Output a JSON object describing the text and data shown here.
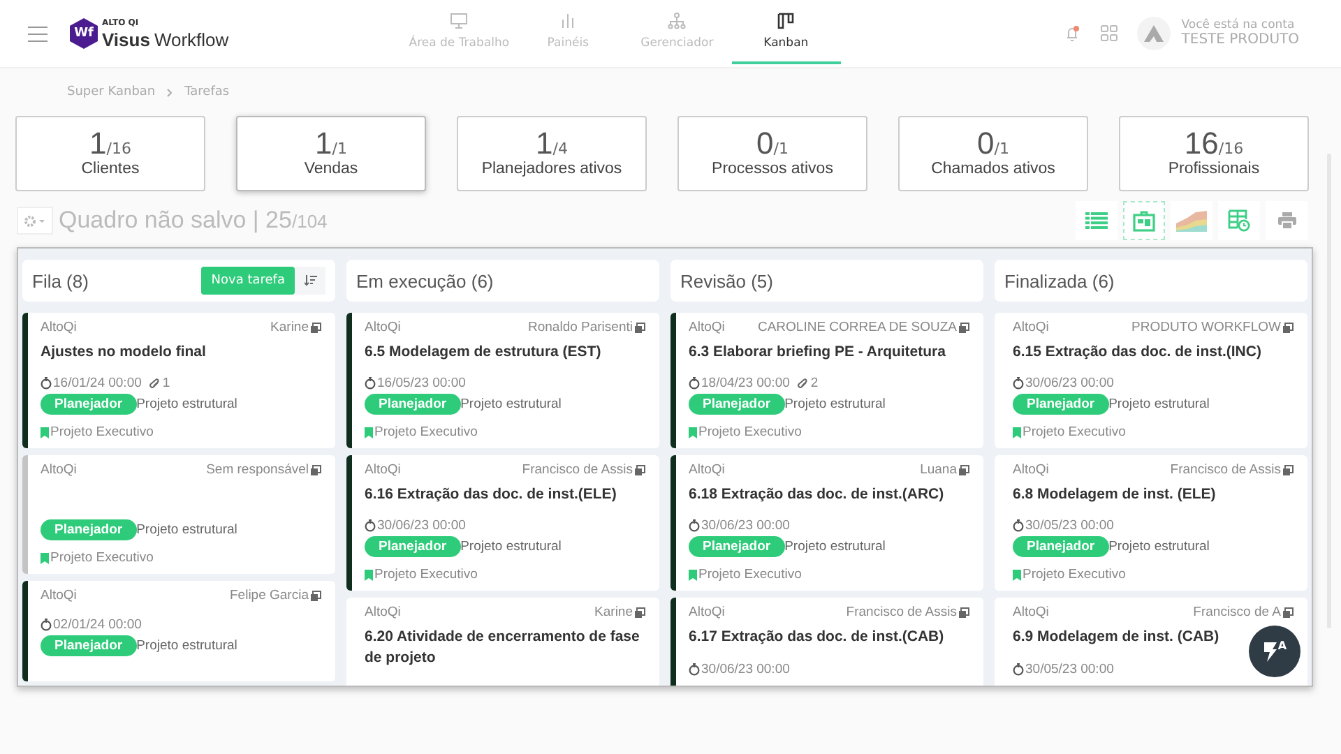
{
  "header": {
    "brand_small": "ALTO QI",
    "brand_bold": "Visus",
    "brand_light": "Workflow",
    "logo_text": "Wf",
    "nav": [
      {
        "label": "Área de Trabalho",
        "kind": "monitor",
        "selected": false
      },
      {
        "label": "Painéis",
        "kind": "bars",
        "selected": false
      },
      {
        "label": "Gerenciador",
        "kind": "tree",
        "selected": false
      },
      {
        "label": "Kanban",
        "kind": "kanban",
        "selected": true
      }
    ],
    "account_caption": "Você está na conta",
    "account_name": "TESTE PRODUTO"
  },
  "breadcrumb": [
    "Super Kanban",
    "Tarefas"
  ],
  "stats": [
    {
      "value": "1",
      "total": "/16",
      "label": "Clientes",
      "selected": false
    },
    {
      "value": "1",
      "total": "/1",
      "label": "Vendas",
      "selected": true
    },
    {
      "value": "1",
      "total": "/4",
      "label": "Planejadores ativos",
      "selected": false
    },
    {
      "value": "0",
      "total": "/1",
      "label": "Processos ativos",
      "selected": false
    },
    {
      "value": "0",
      "total": "/1",
      "label": "Chamados ativos",
      "selected": false
    },
    {
      "value": "16",
      "total": "/16",
      "label": "Profissionais",
      "selected": false
    }
  ],
  "board_title": "Quadro não salvo | 25",
  "board_total": "/104",
  "views": [
    {
      "kind": "list",
      "selected": false
    },
    {
      "kind": "kanban",
      "selected": true
    },
    {
      "kind": "chart",
      "selected": false
    },
    {
      "kind": "schedule",
      "selected": false
    },
    {
      "kind": "print",
      "selected": false
    }
  ],
  "columns": [
    {
      "title": "Fila (8)",
      "new_button": "Nova tarefa",
      "cards": [
        {
          "company": "AltoQi",
          "assignee": "Karine",
          "title": "Ajustes no modelo final",
          "date": "16/01/24 00:00",
          "attachments": "1",
          "tag": "Planejador",
          "project": "Projeto estrutural",
          "phase": "Projeto Executivo",
          "color": "#0f2e1e"
        },
        {
          "company": "AltoQi",
          "assignee": "Sem responsável",
          "tag": "Planejador",
          "project": "Projeto estrutural",
          "phase": "Projeto Executivo",
          "color": "#c4c4c4"
        },
        {
          "company": "AltoQi",
          "assignee": "Felipe Garcia",
          "date": "02/01/24 00:00",
          "tag": "Planejador",
          "project": "Projeto estrutural",
          "color": "#0f2e1e"
        }
      ]
    },
    {
      "title": "Em execução (6)",
      "cards": [
        {
          "company": "AltoQi",
          "assignee": "Ronaldo Parisenti",
          "title": "6.5 Modelagem de estrutura (EST)",
          "date": "16/05/23 00:00",
          "tag": "Planejador",
          "project": "Projeto estrutural",
          "phase": "Projeto Executivo",
          "color": "#0f2e1e"
        },
        {
          "company": "AltoQi",
          "assignee": "Francisco de Assis",
          "title": "6.16 Extração das doc. de inst.(ELE)",
          "date": "30/06/23 00:00",
          "tag": "Planejador",
          "project": "Projeto estrutural",
          "phase": "Projeto Executivo",
          "color": "#0f2e1e"
        },
        {
          "company": "AltoQi",
          "assignee": "Karine",
          "title": "6.20 Atividade de encerramento de fase de projeto",
          "color": "#ffffff"
        }
      ]
    },
    {
      "title": "Revisão (5)",
      "cards": [
        {
          "company": "AltoQi",
          "assignee": "CAROLINE CORREA DE SOUZA",
          "title": "6.3 Elaborar briefing PE - Arquitetura",
          "date": "18/04/23 00:00",
          "attachments": "2",
          "tag": "Planejador",
          "project": "Projeto estrutural",
          "phase": "Projeto Executivo",
          "color": "#0f2e1e"
        },
        {
          "company": "AltoQi",
          "assignee": "Luana",
          "title": "6.18 Extração das doc. de inst.(ARC)",
          "date": "30/06/23 00:00",
          "tag": "Planejador",
          "project": "Projeto estrutural",
          "phase": "Projeto Executivo",
          "color": "#0f2e1e"
        },
        {
          "company": "AltoQi",
          "assignee": "Francisco de Assis",
          "title": "6.17 Extração das doc. de inst.(CAB)",
          "date": "30/06/23 00:00",
          "color": "#0f2e1e"
        }
      ]
    },
    {
      "title": "Finalizada (6)",
      "cards": [
        {
          "company": "AltoQi",
          "assignee": "PRODUTO WORKFLOW",
          "title": "6.15 Extração das doc. de inst.(INC)",
          "date": "30/06/23 00:00",
          "tag": "Planejador",
          "project": "Projeto estrutural",
          "phase": "Projeto Executivo",
          "color": "#ffffff"
        },
        {
          "company": "AltoQi",
          "assignee": "Francisco de Assis",
          "title": "6.8 Modelagem de inst. (ELE)",
          "date": "30/05/23 00:00",
          "tag": "Planejador",
          "project": "Projeto estrutural",
          "phase": "Projeto Executivo",
          "color": "#ffffff"
        },
        {
          "company": "AltoQi",
          "assignee": "Francisco de A",
          "title": "6.9 Modelagem de inst. (CAB)",
          "date": "30/05/23 00:00",
          "color": "#ffffff"
        }
      ]
    }
  ],
  "assistant_button": {
    "label": "A"
  }
}
